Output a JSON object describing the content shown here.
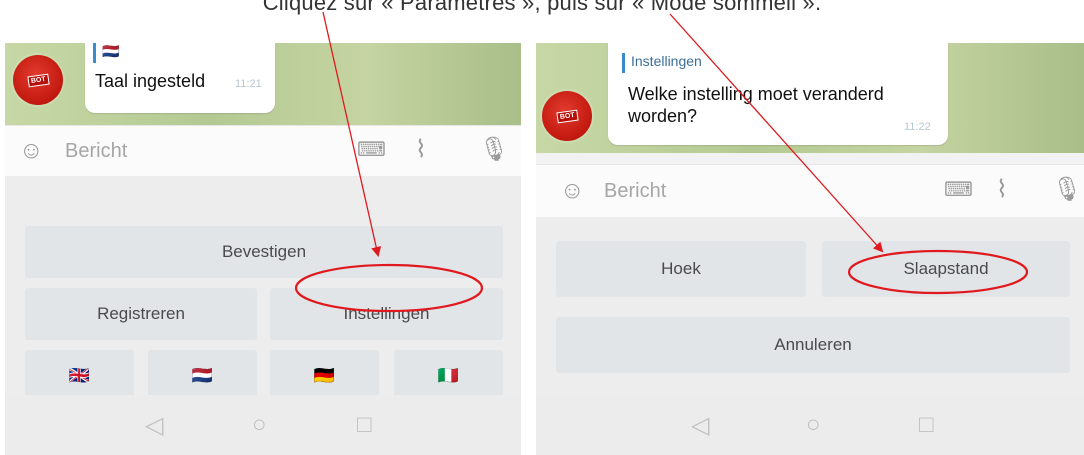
{
  "caption": "Cliquez sur « Paramètres », puis sur « Mode sommeil ».",
  "left_screen": {
    "message": {
      "reply_flag": "🇳🇱",
      "text": "Taal ingesteld",
      "time": "11:21"
    },
    "input": {
      "placeholder": "Bericht"
    },
    "keyboard": {
      "confirm_label": "Bevestigen",
      "register_label": "Registreren",
      "settings_label": "Instellingen",
      "flags": [
        "🇬🇧",
        "🇳🇱",
        "🇩🇪",
        "🇮🇹"
      ]
    }
  },
  "right_screen": {
    "message": {
      "reply_label": "Instellingen",
      "text": "Welke instelling moet veranderd worden?",
      "time": "11:22"
    },
    "input": {
      "placeholder": "Bericht"
    },
    "keyboard": {
      "angle_label": "Hoek",
      "sleep_label": "Slaapstand",
      "cancel_label": "Annuleren"
    }
  },
  "colors": {
    "annotation_red": "#e0191e",
    "button_bg": "#e1e5e8",
    "chat_green": "#b9cc97",
    "reply_blue": "#3a8ccf"
  },
  "icons": {
    "emoji": "smiley-icon",
    "keyboard": "keyboard-icon",
    "attach": "paperclip-icon",
    "mic": "microphone-icon",
    "back": "back-triangle-icon",
    "home": "home-circle-icon",
    "recents": "recents-square-icon"
  }
}
